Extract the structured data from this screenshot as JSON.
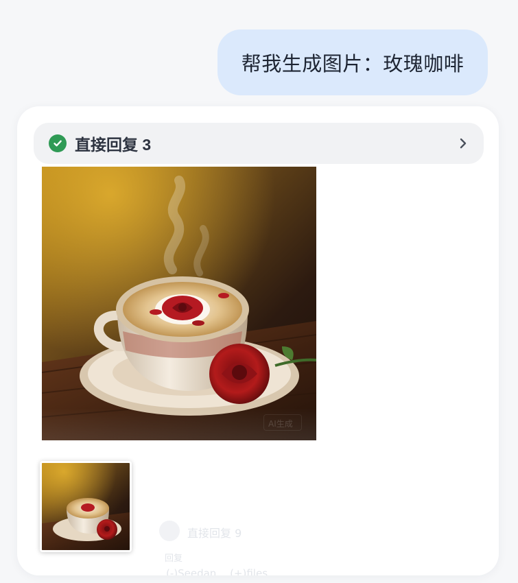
{
  "user_message": {
    "text": "帮我生成图片：玫瑰咖啡"
  },
  "reply": {
    "status_label": "直接回复 3",
    "status_icon": "check-circle-icon",
    "expand_icon": "chevron-right-icon",
    "accent_color": "#2f9a55",
    "image_subject": "rose latte art coffee cup with a red rose on a wooden table",
    "watermark": "AI生成"
  },
  "ghost_content": {
    "label": "直接回复 9",
    "line_1": "回复",
    "line_2": "(-)Seedan…   (+)files"
  },
  "colors": {
    "page_bg": "#f6f7f9",
    "user_bubble_bg": "#dbe9fc",
    "card_bg": "#ffffff"
  }
}
